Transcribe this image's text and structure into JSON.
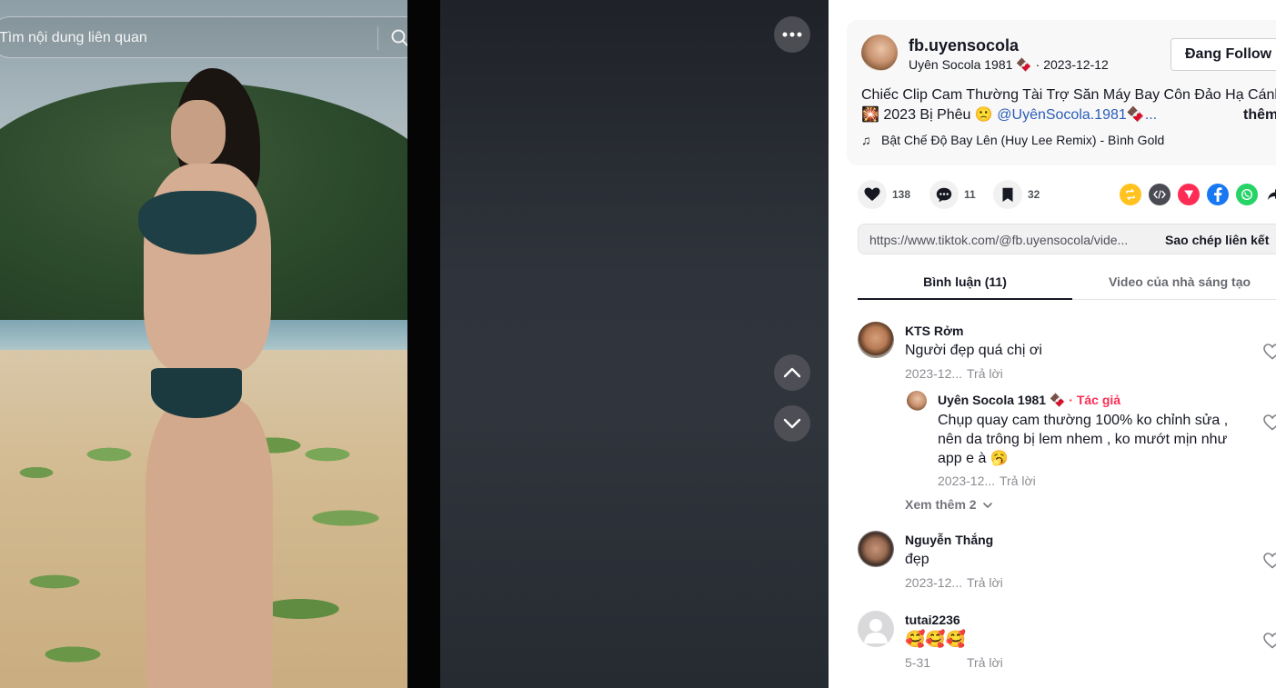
{
  "search": {
    "placeholder": "Tìm nội dung liên quan"
  },
  "post": {
    "username": "fb.uyensocola",
    "display_name": "Uyên Socola 1981",
    "display_emoji": "🍫",
    "date": "2023-12-12",
    "follow_label": "Đang Follow",
    "caption_line1": "Chiếc Clip Cam Thường Tài Trợ Săn Máy Bay Côn Đảo Hạ Cánh",
    "caption_line2_prefix": "🎇 2023 Bị Phêu 🙁 ",
    "caption_mention": "@UyênSocola.1981🍫...",
    "caption_more": "thêm",
    "music": "Bật Chế Độ Bay Lên (Huy Lee Remix) - Bình Gold"
  },
  "actions": {
    "likes": "138",
    "comments": "11",
    "favorites": "32"
  },
  "link": {
    "url": "https://www.tiktok.com/@fb.uyensocola/vide...",
    "copy_label": "Sao chép liên kết"
  },
  "tabs": {
    "comments": "Bình luận (11)",
    "creator_videos": "Video của nhà sáng tạo"
  },
  "comments": [
    {
      "user": "KTS Rởm",
      "text": "Người đẹp quá chị ơi",
      "date": "2023-12...",
      "reply": "Trả lời"
    },
    {
      "user": "Nguyễn Thắng",
      "text": "đẹp",
      "date": "2023-12...",
      "reply": "Trả lời"
    },
    {
      "user": "tutai2236",
      "text": "🥰🥰🥰",
      "date": "5-31",
      "reply": "Trả lời"
    }
  ],
  "reply": {
    "user": "Uyên Socola 1981 🍫",
    "badge": " · Tác giả",
    "text": "Chụp quay cam thường 100% ko chỉnh sửa , nên da trông bị lem nhem , ko mướt mịn như app e à 🥱",
    "date": "2023-12...",
    "reply": "Trả lời"
  },
  "view_more_replies": "Xem thêm 2",
  "colors": {
    "accent": "#fe2c55",
    "mention": "#2b5db9",
    "repost": "#ffc21e",
    "facebook": "#1877f2",
    "whatsapp": "#25d366"
  },
  "icons": {
    "search": "search-icon",
    "more": "more-horizontal-icon",
    "prev": "chevron-up-icon",
    "next": "chevron-down-icon",
    "like": "heart-icon",
    "comment": "comment-icon",
    "favorite": "bookmark-icon",
    "music": "music-note-icon"
  }
}
